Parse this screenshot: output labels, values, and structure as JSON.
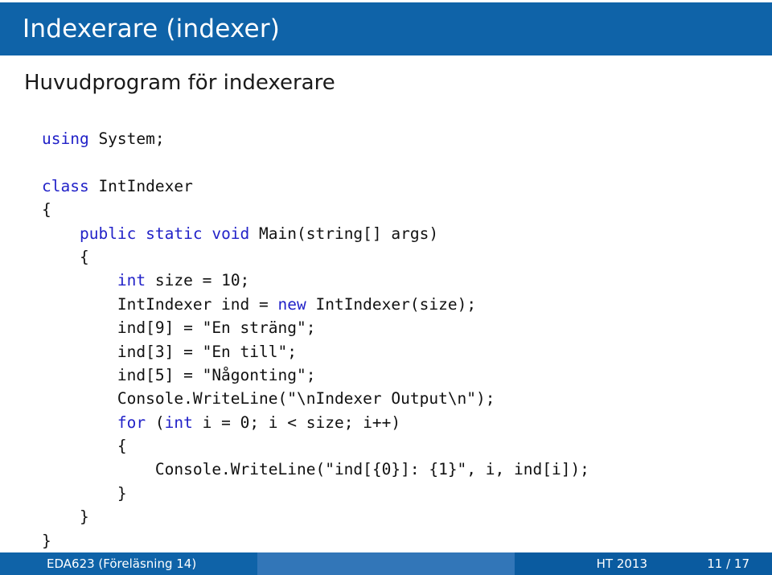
{
  "slide": {
    "title_bar": {
      "title": "Indexerare (indexer)",
      "background_color": "#0f63a8",
      "text_color": "#ffffff"
    },
    "frame_title": "Huvudprogram för indexerare",
    "code": {
      "language": "csharp",
      "keyword_color": "#2222c8",
      "text_color": "#111111",
      "lines": [
        [
          {
            "t": "using",
            "k": true
          },
          {
            "t": " System;",
            "k": false
          }
        ],
        [
          {
            "t": "",
            "k": false
          }
        ],
        [
          {
            "t": "class",
            "k": true
          },
          {
            "t": " IntIndexer",
            "k": false
          }
        ],
        [
          {
            "t": "{",
            "k": false
          }
        ],
        [
          {
            "t": "    ",
            "k": false
          },
          {
            "t": "public static void",
            "k": true
          },
          {
            "t": " Main(string[] args)",
            "k": false
          }
        ],
        [
          {
            "t": "    {",
            "k": false
          }
        ],
        [
          {
            "t": "        ",
            "k": false
          },
          {
            "t": "int",
            "k": true
          },
          {
            "t": " size = 10;",
            "k": false
          }
        ],
        [
          {
            "t": "        IntIndexer ind = ",
            "k": false
          },
          {
            "t": "new",
            "k": true
          },
          {
            "t": " IntIndexer(size);",
            "k": false
          }
        ],
        [
          {
            "t": "        ind[9] = \"En sträng\";",
            "k": false
          }
        ],
        [
          {
            "t": "        ind[3] = \"En till\";",
            "k": false
          }
        ],
        [
          {
            "t": "        ind[5] = \"Någonting\";",
            "k": false
          }
        ],
        [
          {
            "t": "        Console.WriteLine(\"\\nIndexer Output\\n\");",
            "k": false
          }
        ],
        [
          {
            "t": "        ",
            "k": false
          },
          {
            "t": "for",
            "k": true
          },
          {
            "t": " (",
            "k": false
          },
          {
            "t": "int",
            "k": true
          },
          {
            "t": " i = 0; i < size; i++)",
            "k": false
          }
        ],
        [
          {
            "t": "        {",
            "k": false
          }
        ],
        [
          {
            "t": "            Console.WriteLine(\"ind[{0}]: {1}\", i, ind[i]);",
            "k": false
          }
        ],
        [
          {
            "t": "        }",
            "k": false
          }
        ],
        [
          {
            "t": "    }",
            "k": false
          }
        ],
        [
          {
            "t": "}",
            "k": false
          }
        ]
      ]
    },
    "footer": {
      "course": "EDA623  (Föreläsning 14)",
      "term": "HT 2013",
      "page": "11 / 17",
      "left_color": "#0f63a8",
      "mid_color": "#3276b8",
      "right_color": "#0a5ba0"
    }
  }
}
